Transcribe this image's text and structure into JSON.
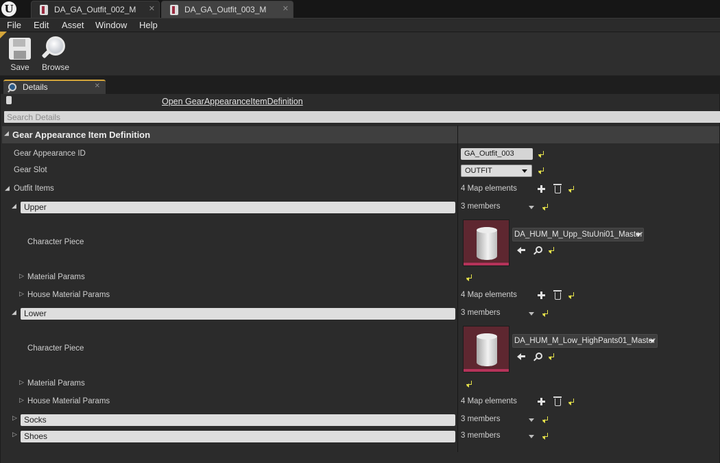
{
  "tabs": [
    {
      "label": "DA_GA_Outfit_002_M",
      "active": false
    },
    {
      "label": "DA_GA_Outfit_003_M",
      "active": true
    }
  ],
  "menu": [
    "File",
    "Edit",
    "Asset",
    "Window",
    "Help"
  ],
  "toolbar": {
    "save_label": "Save",
    "browse_label": "Browse"
  },
  "panel": {
    "tab_label": "Details",
    "open_link": "Open GearAppearanceItemDefinition",
    "search_placeholder": "Search Details"
  },
  "category": {
    "title": "Gear Appearance Item Definition"
  },
  "properties": {
    "gear_appearance_id": {
      "label": "Gear Appearance ID",
      "value": "GA_Outfit_003"
    },
    "gear_slot": {
      "label": "Gear Slot",
      "value": "OUTFIT"
    },
    "outfit_items": {
      "label": "Outfit Items",
      "value": "4 Map elements"
    }
  },
  "upper": {
    "label": "Upper",
    "members": "3 members",
    "character_piece_label": "Character Piece",
    "asset": "DA_HUM_M_Upp_StuUni01_Master",
    "material_params_label": "Material Params",
    "house_material_params_label": "House Material Params",
    "house_material_params_value": "4 Map elements"
  },
  "lower": {
    "label": "Lower",
    "members": "3 members",
    "character_piece_label": "Character Piece",
    "asset": "DA_HUM_M_Low_HighPants01_Master",
    "material_params_label": "Material Params",
    "house_material_params_label": "House Material Params",
    "house_material_params_value": "4 Map elements"
  },
  "socks": {
    "label": "Socks",
    "members": "3 members"
  },
  "shoes": {
    "label": "Shoes",
    "members": "3 members"
  },
  "colors": {
    "accent": "#d4a53a",
    "reset_arrow": "#e5e14a",
    "thumbnail_bg": "#5e2730",
    "thumbnail_bar": "#b5335a"
  }
}
